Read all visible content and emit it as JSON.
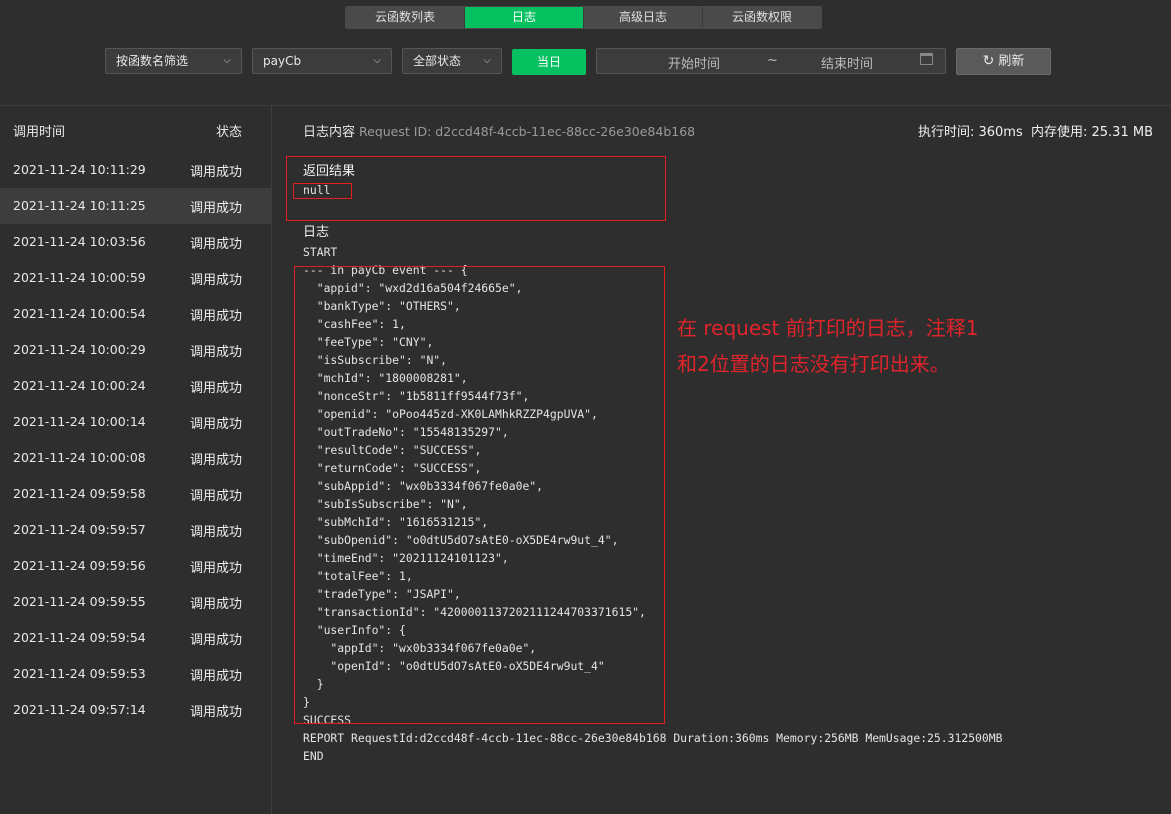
{
  "tabs": [
    "云函数列表",
    "日志",
    "高级日志",
    "云函数权限"
  ],
  "filters": {
    "filter_type": "按函数名筛选",
    "function_name": "payCb",
    "status_filter": "全部状态",
    "today_button": "当日",
    "start_placeholder": "开始时间",
    "range_sep": "~",
    "end_placeholder": "结束时间",
    "refresh_button": "刷新"
  },
  "list": {
    "col_time": "调用时间",
    "col_status": "状态",
    "rows": [
      {
        "time": "2021-11-24 10:11:29",
        "status": "调用成功"
      },
      {
        "time": "2021-11-24 10:11:25",
        "status": "调用成功"
      },
      {
        "time": "2021-11-24 10:03:56",
        "status": "调用成功"
      },
      {
        "time": "2021-11-24 10:00:59",
        "status": "调用成功"
      },
      {
        "time": "2021-11-24 10:00:54",
        "status": "调用成功"
      },
      {
        "time": "2021-11-24 10:00:29",
        "status": "调用成功"
      },
      {
        "time": "2021-11-24 10:00:24",
        "status": "调用成功"
      },
      {
        "time": "2021-11-24 10:00:14",
        "status": "调用成功"
      },
      {
        "time": "2021-11-24 10:00:08",
        "status": "调用成功"
      },
      {
        "time": "2021-11-24 09:59:58",
        "status": "调用成功"
      },
      {
        "time": "2021-11-24 09:59:57",
        "status": "调用成功"
      },
      {
        "time": "2021-11-24 09:59:56",
        "status": "调用成功"
      },
      {
        "time": "2021-11-24 09:59:55",
        "status": "调用成功"
      },
      {
        "time": "2021-11-24 09:59:54",
        "status": "调用成功"
      },
      {
        "time": "2021-11-24 09:59:53",
        "status": "调用成功"
      },
      {
        "time": "2021-11-24 09:57:14",
        "status": "调用成功"
      }
    ]
  },
  "detail": {
    "title": "日志内容",
    "request_id_label": "Request ID: d2ccd48f-4ccb-11ec-88cc-26e30e84b168",
    "exec_time": "执行时间: 360ms",
    "mem_usage": "内存使用: 25.31 MB",
    "result_title": "返回结果",
    "result_value": "null",
    "log_title": "日志",
    "log_lines": [
      "START",
      "--- in payCb event --- {",
      "  \"appid\": \"wxd2d16a504f24665e\",",
      "  \"bankType\": \"OTHERS\",",
      "  \"cashFee\": 1,",
      "  \"feeType\": \"CNY\",",
      "  \"isSubscribe\": \"N\",",
      "  \"mchId\": \"1800008281\",",
      "  \"nonceStr\": \"1b5811ff9544f73f\",",
      "  \"openid\": \"oPoo445zd-XK0LAMhkRZZP4gpUVA\",",
      "  \"outTradeNo\": \"15548135297\",",
      "  \"resultCode\": \"SUCCESS\",",
      "  \"returnCode\": \"SUCCESS\",",
      "  \"subAppid\": \"wx0b3334f067fe0a0e\",",
      "  \"subIsSubscribe\": \"N\",",
      "  \"subMchId\": \"1616531215\",",
      "  \"subOpenid\": \"o0dtU5dO7sAtE0-oX5DE4rw9ut_4\",",
      "  \"timeEnd\": \"20211124101123\",",
      "  \"totalFee\": 1,",
      "  \"tradeType\": \"JSAPI\",",
      "  \"transactionId\": \"4200001137202111244703371615\",",
      "  \"userInfo\": {",
      "    \"appId\": \"wx0b3334f067fe0a0e\",",
      "    \"openId\": \"o0dtU5dO7sAtE0-oX5DE4rw9ut_4\"",
      "  }",
      "}",
      "SUCCESS",
      "REPORT RequestId:d2ccd48f-4ccb-11ec-88cc-26e30e84b168 Duration:360ms Memory:256MB MemUsage:25.312500MB",
      "END"
    ]
  },
  "annotation": {
    "text": "在 request 前打印的日志，注释1和2位置的日志没有打印出来。"
  },
  "colors": {
    "accent": "#07c160",
    "annotation": "#e0242b",
    "background": "#2e2e2e"
  }
}
